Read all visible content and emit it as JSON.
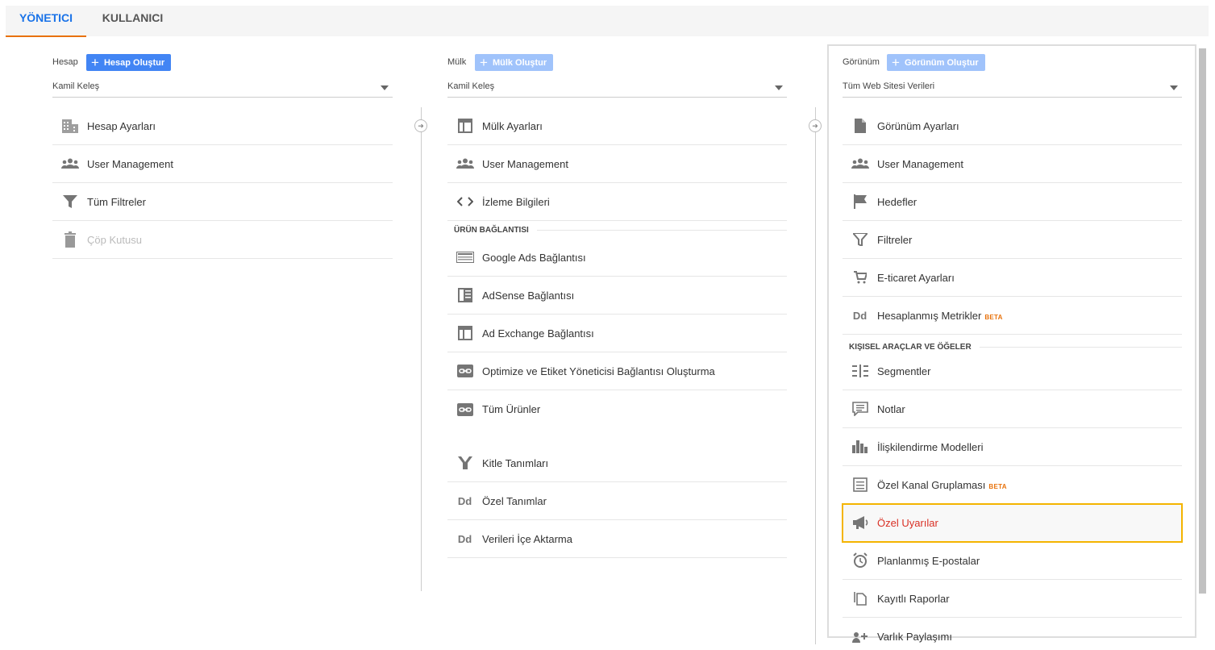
{
  "tabs": [
    {
      "label": "YÖNETICI",
      "active": true
    },
    {
      "label": "KULLANICI",
      "active": false
    }
  ],
  "account": {
    "label": "Hesap",
    "create_label": "Hesap Oluştur",
    "selected": "Kamil Keleş",
    "items": [
      {
        "label": "Hesap Ayarları",
        "icon": "building-icon"
      },
      {
        "label": "User Management",
        "icon": "users-icon"
      },
      {
        "label": "Tüm Filtreler",
        "icon": "filter-icon"
      },
      {
        "label": "Çöp Kutusu",
        "icon": "trash-icon",
        "disabled": true
      }
    ]
  },
  "property": {
    "label": "Mülk",
    "create_label": "Mülk Oluştur",
    "selected": "Kamil Keleş",
    "items": [
      {
        "label": "Mülk Ayarları",
        "icon": "layout-icon"
      },
      {
        "label": "User Management",
        "icon": "users-icon"
      },
      {
        "label": "İzleme Bilgileri",
        "icon": "code-icon"
      }
    ],
    "section_label": "ÜRÜN BAĞLANTISI",
    "link_items": [
      {
        "label": "Google Ads Bağlantısı",
        "icon": "ads-icon"
      },
      {
        "label": "AdSense Bağlantısı",
        "icon": "adsense-icon"
      },
      {
        "label": "Ad Exchange Bağlantısı",
        "icon": "layout-icon"
      },
      {
        "label": "Optimize ve Etiket Yöneticisi Bağlantısı Oluşturma",
        "icon": "link-icon"
      },
      {
        "label": "Tüm Ürünler",
        "icon": "link-icon"
      }
    ],
    "extra_items": [
      {
        "label": "Kitle Tanımları",
        "icon": "audience-icon"
      },
      {
        "label": "Özel Tanımlar",
        "icon": "dd-icon"
      },
      {
        "label": "Verileri İçe Aktarma",
        "icon": "dd-icon"
      }
    ]
  },
  "view": {
    "label": "Görünüm",
    "create_label": "Görünüm Oluştur",
    "selected": "Tüm Web Sitesi Verileri",
    "items": [
      {
        "label": "Görünüm Ayarları",
        "icon": "document-icon"
      },
      {
        "label": "User Management",
        "icon": "users-icon"
      },
      {
        "label": "Hedefler",
        "icon": "flag-icon"
      },
      {
        "label": "Filtreler",
        "icon": "filter-icon"
      },
      {
        "label": "E-ticaret Ayarları",
        "icon": "cart-icon"
      },
      {
        "label": "Hesaplanmış Metrikler",
        "icon": "dd-icon",
        "badge": "BETA"
      }
    ],
    "section_label": "KIŞISEL ARAÇLAR VE ÖĞELER",
    "tool_items": [
      {
        "label": "Segmentler",
        "icon": "segments-icon"
      },
      {
        "label": "Notlar",
        "icon": "notes-icon"
      },
      {
        "label": "İlişkilendirme Modelleri",
        "icon": "bar-chart-icon"
      },
      {
        "label": "Özel Kanal Gruplaması",
        "icon": "channel-icon",
        "badge": "BETA"
      },
      {
        "label": "Özel Uyarılar",
        "icon": "megaphone-icon",
        "highlighted": true
      },
      {
        "label": "Planlanmış E-postalar",
        "icon": "alarm-icon"
      },
      {
        "label": "Kayıtlı Raporlar",
        "icon": "copy-icon"
      },
      {
        "label": "Varlık Paylaşımı",
        "icon": "share-icon"
      }
    ]
  }
}
